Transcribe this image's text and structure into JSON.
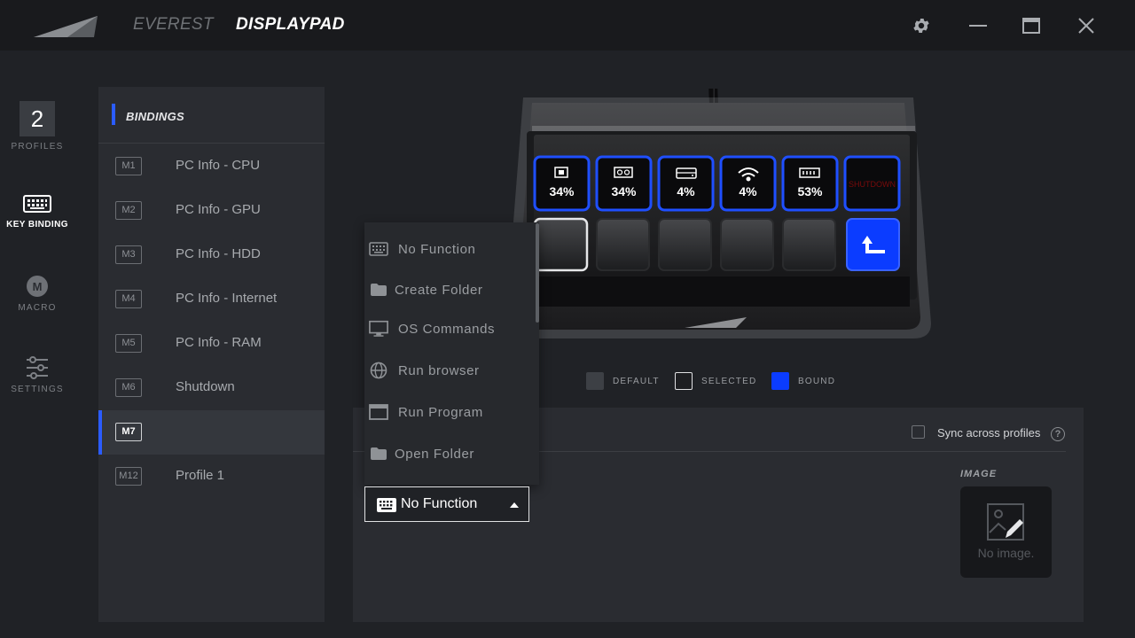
{
  "header": {
    "tabs": [
      {
        "label": "EVEREST"
      },
      {
        "label": "DISPLAYPAD"
      }
    ]
  },
  "nav": {
    "profile_number": "2",
    "items": [
      {
        "label": "PROFILES",
        "icon": "profile-number-icon"
      },
      {
        "label": "KEY BINDING",
        "icon": "keyboard-icon"
      },
      {
        "label": "MACRO",
        "icon": "macro-m-icon"
      },
      {
        "label": "SETTINGS",
        "icon": "sliders-icon"
      }
    ]
  },
  "bindings": {
    "title": "BINDINGS",
    "rows": [
      {
        "key": "M1",
        "name": "PC Info - CPU"
      },
      {
        "key": "M2",
        "name": "PC Info - GPU"
      },
      {
        "key": "M3",
        "name": "PC Info - HDD"
      },
      {
        "key": "M4",
        "name": "PC Info - Internet"
      },
      {
        "key": "M5",
        "name": "PC Info - RAM"
      },
      {
        "key": "M6",
        "name": "Shutdown"
      },
      {
        "key": "M7",
        "name": ""
      },
      {
        "key": "M12",
        "name": "Profile 1"
      }
    ],
    "active_index": 6
  },
  "device": {
    "keys_top": [
      {
        "icon": "cpu-icon",
        "value": "34%"
      },
      {
        "icon": "gpu-icon",
        "value": "34%"
      },
      {
        "icon": "hdd-icon",
        "value": "4%"
      },
      {
        "icon": "wifi-icon",
        "value": "4%"
      },
      {
        "icon": "ram-icon",
        "value": "53%"
      },
      {
        "icon": "shutdown-icon",
        "value": "SHUTDOWN"
      }
    ],
    "bound_color": "#0b3cff"
  },
  "legend": {
    "default": "DEFAULT",
    "selected": "SELECTED",
    "bound": "BOUND",
    "colors": {
      "default": "#3d4045",
      "selected": "#1e1f22",
      "bound": "#0b3cff"
    }
  },
  "detail": {
    "sync_label": "Sync across profiles",
    "help": "?",
    "image_label": "IMAGE",
    "no_image": "No image."
  },
  "dropdown": {
    "options": [
      {
        "label": "No Function",
        "icon": "keyboard-icon"
      },
      {
        "label": "Create Folder",
        "icon": "folder-icon"
      },
      {
        "label": "OS Commands",
        "icon": "monitor-icon"
      },
      {
        "label": "Run browser",
        "icon": "globe-icon"
      },
      {
        "label": "Run Program",
        "icon": "window-icon"
      },
      {
        "label": "Open Folder",
        "icon": "folder-icon"
      }
    ],
    "selected": "No Function"
  }
}
